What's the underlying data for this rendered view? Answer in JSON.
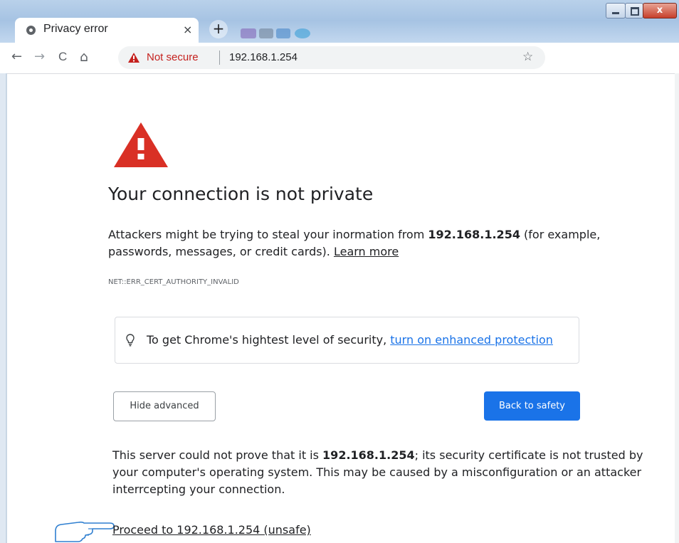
{
  "browser": {
    "tab_title": "Privacy error",
    "tab_close": "×",
    "new_tab": "+",
    "nav": {
      "back": "←",
      "forward": "→",
      "reload": "C",
      "home": "⌂"
    },
    "security_label": "Not secure",
    "url": "192.168.1.254",
    "bookmark_icon": "☆",
    "window_close": "x"
  },
  "page": {
    "heading": "Your connection is not private",
    "para1_before": "Attackers might be trying to steal your inormation from ",
    "para1_host": "192.168.1.254",
    "para1_after": " (for example, passwords, messages, or credit cards). ",
    "learn_more": "Learn more",
    "error_code": "NET::ERR_CERT_AUTHORITY_INVALID",
    "enhanced_text": "To get Chrome's hightest level of security, ",
    "enhanced_link": "turn on enhanced protection",
    "hide_advanced": "Hide advanced",
    "back_to_safety": "Back to safety",
    "para2_before": "This server could not prove that it is ",
    "para2_host": "192.168.1.254",
    "para2_after": "; its security certificate is not trusted by your computer's operating system. This may be caused by a misconfiguration or an attacker interrcepting your connection.",
    "proceed_link": "Proceed to 192.168.1.254 (unsafe)"
  },
  "colors": {
    "warning_red": "#d93025",
    "link_blue": "#1a73e8",
    "button_blue": "#1a73e8",
    "not_secure_red": "#c5221f"
  },
  "icons": {
    "tab": "globe-icon",
    "warning": "warning-triangle-icon",
    "bulb": "lightbulb-icon",
    "star": "star-icon",
    "pointer": "pointing-hand-icon"
  }
}
